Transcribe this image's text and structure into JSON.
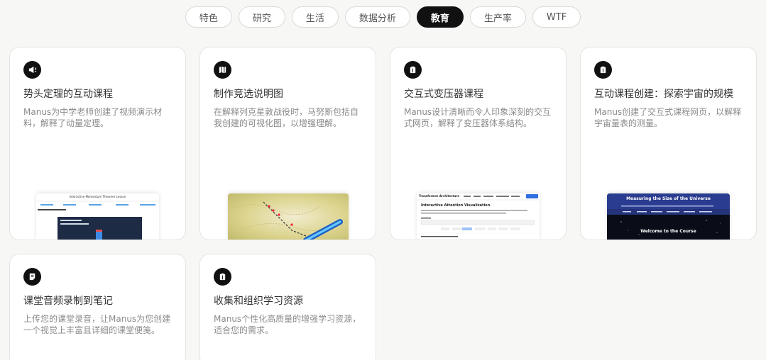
{
  "tabs": [
    {
      "label": "特色",
      "active": false
    },
    {
      "label": "研究",
      "active": false
    },
    {
      "label": "生活",
      "active": false
    },
    {
      "label": "数据分析",
      "active": false
    },
    {
      "label": "教育",
      "active": true
    },
    {
      "label": "生产率",
      "active": false
    },
    {
      "label": "WTF",
      "active": false
    }
  ],
  "cards": [
    {
      "title": "势头定理的互动课程",
      "desc": "Manus为中学老师创建了视频演示材料，解释了动量定理。",
      "icon": "megaphone-icon"
    },
    {
      "title": "制作竞选说明图",
      "desc": "在解释列克星敦战役时，马努斯包括自我创建的可视化图，以增强理解。",
      "icon": "map-icon"
    },
    {
      "title": "交互式变压器课程",
      "desc": "Manus设计清晰而令人印象深刻的交互式网页，解释了变压器体系结构。",
      "icon": "book-icon"
    },
    {
      "title": "互动课程创建：探索宇宙的规模",
      "desc": "Manus创建了交互式课程网页，以解释宇宙量表的测量。",
      "icon": "book-icon"
    },
    {
      "title": "课堂音频录制到笔记",
      "desc": "上传您的课堂录音，让Manus为您创建一个视觉上丰富且详细的课堂便笺。",
      "icon": "note-icon"
    },
    {
      "title": "收集和组织学习资源",
      "desc": "Manus个性化高质量的增强学习资源，适合您的需求。",
      "icon": "book-icon"
    }
  ],
  "previews": {
    "momentum": {
      "heading": "Interactive Momentum Theorem Lesson"
    },
    "transformer": {
      "brand": "Transformer Architecture",
      "heading": "Interactive Attention Visualization"
    },
    "universe": {
      "heading": "Measuring the Size of the Universe",
      "welcome": "Welcome to the Course"
    }
  }
}
